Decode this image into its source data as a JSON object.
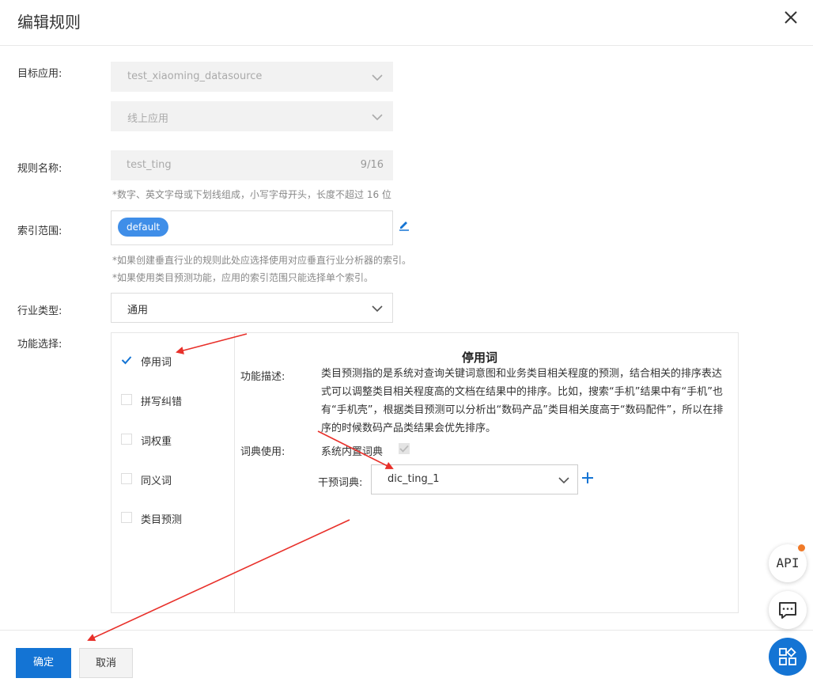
{
  "dialog": {
    "title": "编辑规则"
  },
  "form": {
    "target_app_label": "目标应用:",
    "target_app_value": "test_xiaoming_datasource",
    "target_app_type": "线上应用",
    "rule_name_label": "规则名称:",
    "rule_name_value": "test_ting",
    "rule_name_count": "9/16",
    "rule_name_hint": "*数字、英文字母或下划线组成，小写字母开头，长度不超过 16 位",
    "index_label": "索引范围:",
    "index_tag": "default",
    "index_hint_1": "*如果创建垂直行业的规则此处应选择使用对应垂直行业分析器的索引。",
    "index_hint_2": "*如果使用类目预测功能，应用的索引范围只能选择单个索引。",
    "industry_label": "行业类型:",
    "industry_value": "通用",
    "function_label": "功能选择:"
  },
  "functions": {
    "items": [
      {
        "label": "停用词",
        "checked": true
      },
      {
        "label": "拼写纠错",
        "checked": false
      },
      {
        "label": "词权重",
        "checked": false
      },
      {
        "label": "同义词",
        "checked": false
      },
      {
        "label": "类目预测",
        "checked": false
      }
    ]
  },
  "detail": {
    "title": "停用词",
    "desc_label": "功能描述:",
    "desc_text": "类目预测指的是系统对查询关键词意图和业务类目相关程度的预测，结合相关的排序表达式可以调整类目相关程度高的文档在结果中的排序。比如，搜索“手机”结果中有“手机”也有“手机壳”，根据类目预测可以分析出“数码产品”类目相关度高于“数码配件”，所以在排序的时候数码产品类结果会优先排序。",
    "dict_usage_label": "词典使用:",
    "system_dict_label": "系统内置词典",
    "intervene_label": "干预词典:",
    "intervene_value": "dic_ting_1"
  },
  "footer": {
    "confirm": "确定",
    "cancel": "取消"
  },
  "floating": {
    "api": "API"
  },
  "colors": {
    "primary": "#1474d4",
    "tag": "#3f8ee8",
    "arrow": "#e8302a",
    "badge": "#f07a28"
  }
}
